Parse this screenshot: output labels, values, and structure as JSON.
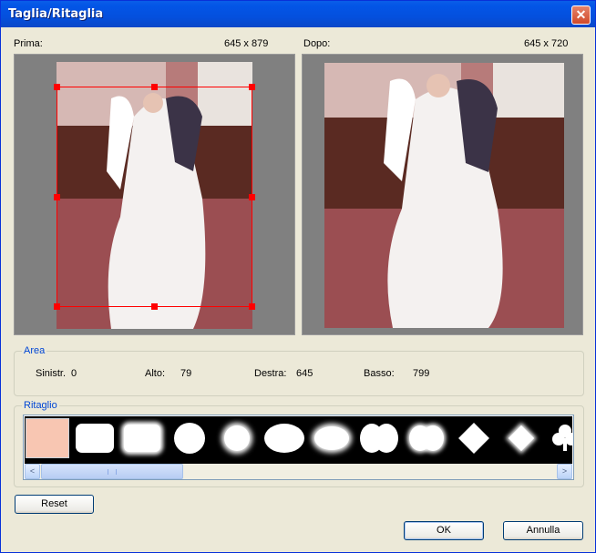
{
  "window": {
    "title": "Taglia/Ritaglia",
    "close_glyph": "✕"
  },
  "before": {
    "label": "Prima:",
    "size": "645 x 879"
  },
  "after": {
    "label": "Dopo:",
    "size": "645 x 720"
  },
  "area": {
    "legend": "Area",
    "left_label": "Sinistr.",
    "left_value": "0",
    "top_label": "Alto:",
    "top_value": "79",
    "right_label": "Destra:",
    "right_value": "645",
    "bottom_label": "Basso:",
    "bottom_value": "799"
  },
  "crop_shapes": {
    "legend": "Ritaglio",
    "items": [
      {
        "name": "none",
        "selected": true
      },
      {
        "name": "rounded-rectangle"
      },
      {
        "name": "soft-rectangle"
      },
      {
        "name": "circle"
      },
      {
        "name": "soft-circle"
      },
      {
        "name": "ellipse"
      },
      {
        "name": "soft-ellipse"
      },
      {
        "name": "double-circle"
      },
      {
        "name": "soft-double-circle"
      },
      {
        "name": "diamond"
      },
      {
        "name": "soft-diamond"
      },
      {
        "name": "club"
      }
    ]
  },
  "scrollbar": {
    "left_glyph": "<",
    "right_glyph": ">",
    "position": 0.0
  },
  "buttons": {
    "reset": "Reset",
    "ok": "OK",
    "cancel": "Annulla"
  },
  "colors": {
    "titlebar": "#0355e6",
    "crop_frame": "#ff0000",
    "group_legend": "#0046d5",
    "selected_thumb": "#f8c6b2"
  }
}
